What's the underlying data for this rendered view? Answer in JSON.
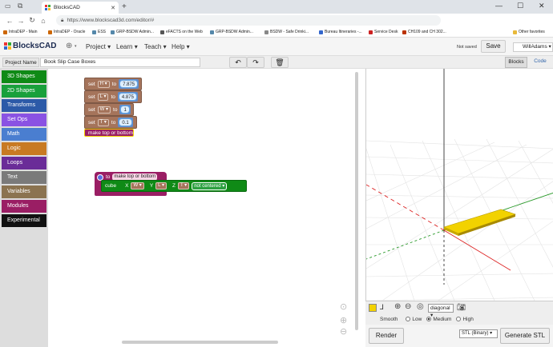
{
  "browser": {
    "tab_title": "BlocksCAD",
    "url": "https://www.blockscad3d.com/editor/#",
    "bookmarks": [
      "IntraDEP - Main",
      "IntraDEP - Oracle",
      "ESS",
      "GRP-BSDW Admin...",
      "eFACTS on the Web",
      "GRP-BSDW Admin...",
      "BSDW - Safe Drinki...",
      "Bureau Itineraries -...",
      "Service Desk",
      "CH109 and CH 302..."
    ],
    "other_favorites": "Other favorites"
  },
  "app": {
    "logo": "BlocksCAD",
    "menus": [
      "Project",
      "Learn",
      "Teach",
      "Help"
    ],
    "status": "Not saved",
    "save_label": "Save",
    "user": "WillAdams",
    "project_label": "Project Name",
    "project_name": "Book Slip Case Boxes",
    "tab_blocks": "Blocks",
    "tab_code": "Code"
  },
  "categories": [
    {
      "label": "3D Shapes",
      "color": "#0f8a16"
    },
    {
      "label": "2D Shapes",
      "color": "#19a03b"
    },
    {
      "label": "Transforms",
      "color": "#2c5aa8"
    },
    {
      "label": "Set Ops",
      "color": "#8a52e3"
    },
    {
      "label": "Math",
      "color": "#4a7ed0"
    },
    {
      "label": "Logic",
      "color": "#c87a22"
    },
    {
      "label": "Loops",
      "color": "#6a2c98"
    },
    {
      "label": "Text",
      "color": "#7a7a7a"
    },
    {
      "label": "Variables",
      "color": "#8b7350"
    },
    {
      "label": "Modules",
      "color": "#9a1e64"
    },
    {
      "label": "Experimental",
      "color": "#111111"
    }
  ],
  "blocks": {
    "set_word": "set",
    "to_word": "to",
    "sets": [
      {
        "var": "H",
        "value": "7.875"
      },
      {
        "var": "L",
        "value": "4.875"
      },
      {
        "var": "W",
        "value": "1"
      },
      {
        "var": "T",
        "value": "0.1"
      }
    ],
    "call": "make top or bottom",
    "def_to": "to",
    "def_name": "make top or bottom",
    "cube": {
      "label": "cube",
      "x_label": "X",
      "x_var": "W",
      "y_label": "Y",
      "y_var": "L",
      "z_label": "Z",
      "z_var": "T",
      "center": "not centered"
    }
  },
  "viewer": {
    "view_select": "diagonal",
    "smooth_label": "Smooth",
    "smooth_options": [
      "Low",
      "Medium",
      "High"
    ],
    "smooth_selected": "Medium",
    "render_label": "Render",
    "format": "STL (Binary)",
    "generate_label": "Generate STL",
    "swatch_color": "#f2d200"
  }
}
